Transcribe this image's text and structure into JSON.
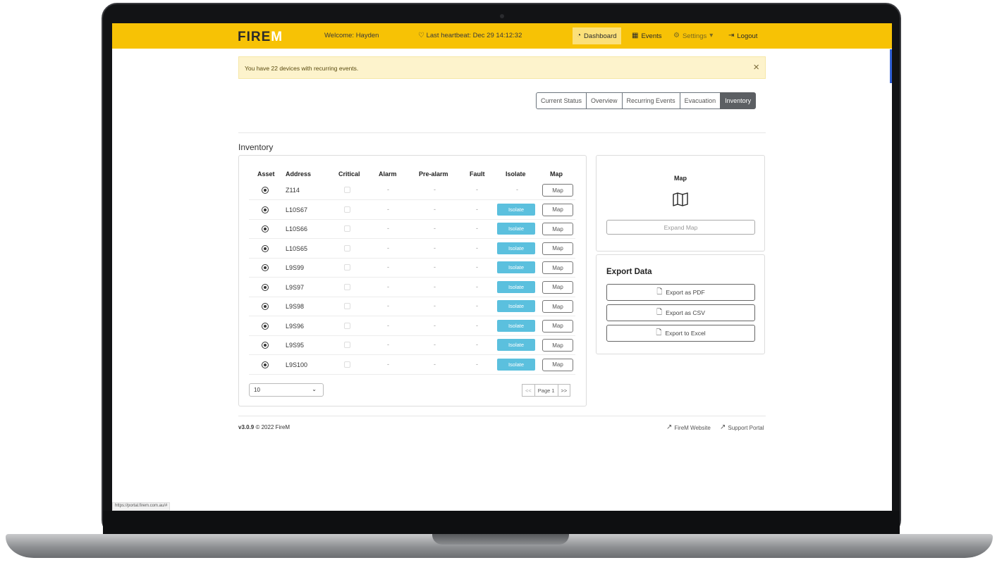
{
  "navbar": {
    "logo_main": "FIRE",
    "logo_accent": "M",
    "welcome": "Welcome: Hayden",
    "heartbeat": "Last heartbeat: Dec 29 14:12:32",
    "links": {
      "dashboard": "Dashboard",
      "events": "Events",
      "settings": "Settings",
      "logout": "Logout"
    },
    "active": "Dashboard"
  },
  "alert": {
    "message": "You have 22 devices with recurring events.",
    "close": "×"
  },
  "tabs": [
    "Current Status",
    "Overview",
    "Recurring Events",
    "Evacuation",
    "Inventory"
  ],
  "active_tab": "Inventory",
  "inventory": {
    "title": "Inventory",
    "columns": [
      "Asset",
      "Address",
      "Critical",
      "Alarm",
      "Pre-alarm",
      "Fault",
      "Isolate",
      "Map"
    ],
    "rows": [
      {
        "address": "Z114",
        "alarm": "-",
        "prealarm": "-",
        "fault": "-",
        "isolate": "-",
        "map": "Map"
      },
      {
        "address": "L10S67",
        "alarm": "-",
        "prealarm": "-",
        "fault": "-",
        "isolate": "Isolate",
        "map": "Map"
      },
      {
        "address": "L10S66",
        "alarm": "-",
        "prealarm": "-",
        "fault": "-",
        "isolate": "Isolate",
        "map": "Map"
      },
      {
        "address": "L10S65",
        "alarm": "-",
        "prealarm": "-",
        "fault": "-",
        "isolate": "Isolate",
        "map": "Map"
      },
      {
        "address": "L9S99",
        "alarm": "-",
        "prealarm": "-",
        "fault": "-",
        "isolate": "Isolate",
        "map": "Map"
      },
      {
        "address": "L9S97",
        "alarm": "-",
        "prealarm": "-",
        "fault": "-",
        "isolate": "Isolate",
        "map": "Map"
      },
      {
        "address": "L9S98",
        "alarm": "-",
        "prealarm": "-",
        "fault": "-",
        "isolate": "Isolate",
        "map": "Map"
      },
      {
        "address": "L9S96",
        "alarm": "-",
        "prealarm": "-",
        "fault": "-",
        "isolate": "Isolate",
        "map": "Map"
      },
      {
        "address": "L9S95",
        "alarm": "-",
        "prealarm": "-",
        "fault": "-",
        "isolate": "Isolate",
        "map": "Map"
      },
      {
        "address": "L9S100",
        "alarm": "-",
        "prealarm": "-",
        "fault": "-",
        "isolate": "Isolate",
        "map": "Map"
      }
    ],
    "page_size": "10",
    "pager": {
      "prev": "<<",
      "page": "Page 1",
      "next": ">>"
    }
  },
  "map_panel": {
    "title": "Map",
    "icon": "map-icon",
    "expand": "Expand Map"
  },
  "export": {
    "title": "Export Data",
    "pdf": "Export as PDF",
    "csv": "Export as CSV",
    "excel": "Export to Excel"
  },
  "footer": {
    "version": "v3.0.9",
    "copyright": "© 2022 FireM",
    "website": "FireM Website",
    "support": "Support Portal"
  },
  "status_url": "https://portal.firem.com.au/#",
  "colors": {
    "navbar": "#f7c205",
    "alert_bg": "#fdf3cc",
    "isolate": "#5bc0de",
    "tab_active": "#5c5f63"
  }
}
